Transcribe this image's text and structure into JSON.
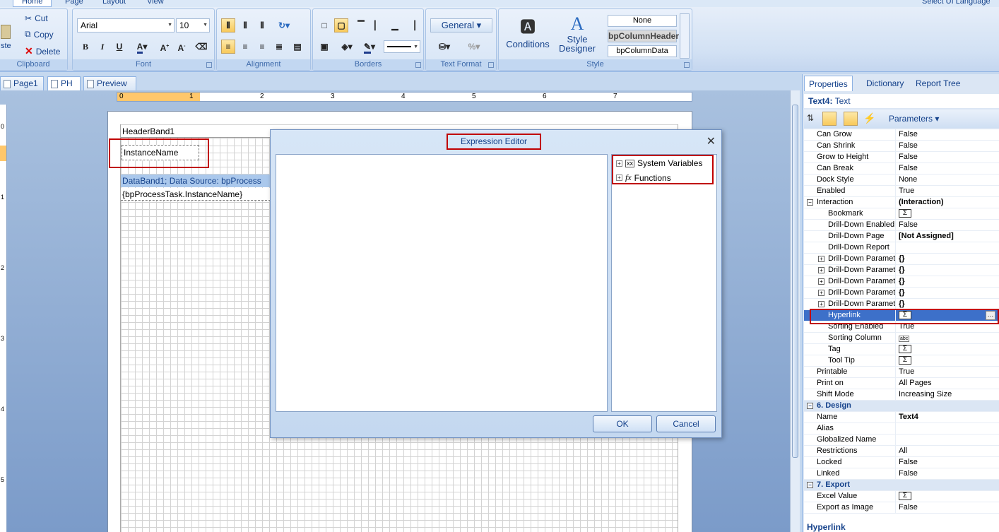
{
  "ribbon": {
    "tabs": [
      "Home",
      "Page",
      "Layout",
      "View"
    ],
    "right_text": "Select UI Language",
    "clipboard": {
      "title": "Clipboard",
      "paste": "ste",
      "cut": "Cut",
      "copy": "Copy",
      "delete": "Delete"
    },
    "font": {
      "title": "Font",
      "family": "Arial",
      "size": "10"
    },
    "alignment": {
      "title": "Alignment"
    },
    "borders": {
      "title": "Borders"
    },
    "text_format": {
      "title": "Text Format",
      "format": "General"
    },
    "style": {
      "title": "Style",
      "conditions": "Conditions",
      "style_designer": "Style\nDesigner",
      "style_items": [
        "None",
        "bpColumnHeader",
        "bpColumnData"
      ]
    }
  },
  "doc_tabs": [
    "Page1",
    "PH",
    "Preview"
  ],
  "ruler": {
    "h_ticks": [
      "0",
      "1",
      "2",
      "3",
      "4",
      "5",
      "6",
      "7"
    ],
    "v_ticks": [
      "0",
      "1",
      "2",
      "3",
      "4",
      "5"
    ]
  },
  "design": {
    "header_band": "HeaderBand1",
    "text_component": "InstanceName",
    "data_band": "DataBand1; Data Source: bpProcess",
    "data_field": "{bpProcessTask.InstanceName}"
  },
  "dialog": {
    "title": "Expression Editor",
    "tree": [
      "System Variables",
      "Functions"
    ],
    "ok": "OK",
    "cancel": "Cancel"
  },
  "panel": {
    "tabs": [
      "Properties",
      "Dictionary",
      "Report Tree"
    ],
    "object_name": "Text4:",
    "object_type": "Text",
    "toolbar_label": "Parameters",
    "description": "Hyperlink",
    "rows": [
      {
        "name": "Can Grow",
        "value": "False",
        "level": 0
      },
      {
        "name": "Can Shrink",
        "value": "False",
        "level": 0
      },
      {
        "name": "Grow to Height",
        "value": "False",
        "level": 0
      },
      {
        "name": "Can Break",
        "value": "False",
        "level": 0
      },
      {
        "name": "Dock Style",
        "value": "None",
        "level": 0
      },
      {
        "name": "Enabled",
        "value": "True",
        "level": 0
      },
      {
        "name": "Interaction",
        "value": "(Interaction)",
        "level": 0,
        "expand": "−",
        "bold": true
      },
      {
        "name": "Bookmark",
        "value": "Σ",
        "level": 1,
        "sigma": true
      },
      {
        "name": "Drill-Down Enabled",
        "value": "False",
        "level": 1
      },
      {
        "name": "Drill-Down Page",
        "value": "[Not Assigned]",
        "level": 1,
        "bold": true
      },
      {
        "name": "Drill-Down Report",
        "value": "",
        "level": 1
      },
      {
        "name": "Drill-Down Paramete",
        "value": "{}",
        "level": 1,
        "expand": "+",
        "bold": true
      },
      {
        "name": "Drill-Down Paramete",
        "value": "{}",
        "level": 1,
        "expand": "+",
        "bold": true
      },
      {
        "name": "Drill-Down Paramete",
        "value": "{}",
        "level": 1,
        "expand": "+",
        "bold": true
      },
      {
        "name": "Drill-Down Paramete",
        "value": "{}",
        "level": 1,
        "expand": "+",
        "bold": true
      },
      {
        "name": "Drill-Down Paramete",
        "value": "{}",
        "level": 1,
        "expand": "+",
        "bold": true
      },
      {
        "name": "Hyperlink",
        "value": "Σ",
        "level": 1,
        "sigma": true,
        "selected": true
      },
      {
        "name": "Sorting Enabled",
        "value": "True",
        "level": 1
      },
      {
        "name": "Sorting Column",
        "value": "abc",
        "level": 1
      },
      {
        "name": "Tag",
        "value": "Σ",
        "level": 1,
        "sigma": true
      },
      {
        "name": "Tool Tip",
        "value": "Σ",
        "level": 1,
        "sigma": true
      },
      {
        "name": "Printable",
        "value": "True",
        "level": 0
      },
      {
        "name": "Print on",
        "value": "All Pages",
        "level": 0
      },
      {
        "name": "Shift Mode",
        "value": "Increasing Size",
        "level": 0
      },
      {
        "name": "6. Design",
        "value": "",
        "level": 0,
        "expand": "−",
        "category": true
      },
      {
        "name": "Name",
        "value": "Text4",
        "level": 0,
        "bold": true
      },
      {
        "name": "Alias",
        "value": "",
        "level": 0
      },
      {
        "name": "Globalized Name",
        "value": "",
        "level": 0
      },
      {
        "name": "Restrictions",
        "value": "All",
        "level": 0
      },
      {
        "name": "Locked",
        "value": "False",
        "level": 0
      },
      {
        "name": "Linked",
        "value": "False",
        "level": 0
      },
      {
        "name": "7. Export",
        "value": "",
        "level": 0,
        "expand": "−",
        "category": true
      },
      {
        "name": "Excel Value",
        "value": "Σ",
        "level": 0,
        "sigma": true
      },
      {
        "name": "Export as Image",
        "value": "False",
        "level": 0
      }
    ]
  }
}
